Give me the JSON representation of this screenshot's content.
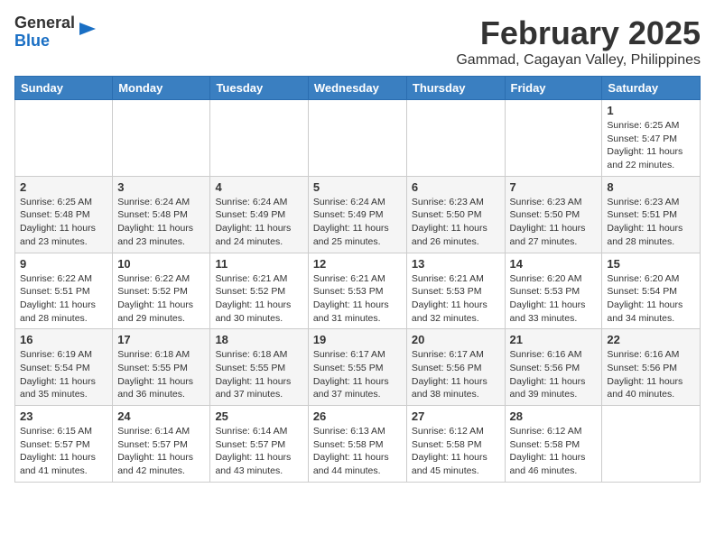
{
  "header": {
    "logo_general": "General",
    "logo_blue": "Blue",
    "month": "February 2025",
    "location": "Gammad, Cagayan Valley, Philippines"
  },
  "weekdays": [
    "Sunday",
    "Monday",
    "Tuesday",
    "Wednesday",
    "Thursday",
    "Friday",
    "Saturday"
  ],
  "weeks": [
    [
      {
        "day": "",
        "info": ""
      },
      {
        "day": "",
        "info": ""
      },
      {
        "day": "",
        "info": ""
      },
      {
        "day": "",
        "info": ""
      },
      {
        "day": "",
        "info": ""
      },
      {
        "day": "",
        "info": ""
      },
      {
        "day": "1",
        "info": "Sunrise: 6:25 AM\nSunset: 5:47 PM\nDaylight: 11 hours\nand 22 minutes."
      }
    ],
    [
      {
        "day": "2",
        "info": "Sunrise: 6:25 AM\nSunset: 5:48 PM\nDaylight: 11 hours\nand 23 minutes."
      },
      {
        "day": "3",
        "info": "Sunrise: 6:24 AM\nSunset: 5:48 PM\nDaylight: 11 hours\nand 23 minutes."
      },
      {
        "day": "4",
        "info": "Sunrise: 6:24 AM\nSunset: 5:49 PM\nDaylight: 11 hours\nand 24 minutes."
      },
      {
        "day": "5",
        "info": "Sunrise: 6:24 AM\nSunset: 5:49 PM\nDaylight: 11 hours\nand 25 minutes."
      },
      {
        "day": "6",
        "info": "Sunrise: 6:23 AM\nSunset: 5:50 PM\nDaylight: 11 hours\nand 26 minutes."
      },
      {
        "day": "7",
        "info": "Sunrise: 6:23 AM\nSunset: 5:50 PM\nDaylight: 11 hours\nand 27 minutes."
      },
      {
        "day": "8",
        "info": "Sunrise: 6:23 AM\nSunset: 5:51 PM\nDaylight: 11 hours\nand 28 minutes."
      }
    ],
    [
      {
        "day": "9",
        "info": "Sunrise: 6:22 AM\nSunset: 5:51 PM\nDaylight: 11 hours\nand 28 minutes."
      },
      {
        "day": "10",
        "info": "Sunrise: 6:22 AM\nSunset: 5:52 PM\nDaylight: 11 hours\nand 29 minutes."
      },
      {
        "day": "11",
        "info": "Sunrise: 6:21 AM\nSunset: 5:52 PM\nDaylight: 11 hours\nand 30 minutes."
      },
      {
        "day": "12",
        "info": "Sunrise: 6:21 AM\nSunset: 5:53 PM\nDaylight: 11 hours\nand 31 minutes."
      },
      {
        "day": "13",
        "info": "Sunrise: 6:21 AM\nSunset: 5:53 PM\nDaylight: 11 hours\nand 32 minutes."
      },
      {
        "day": "14",
        "info": "Sunrise: 6:20 AM\nSunset: 5:53 PM\nDaylight: 11 hours\nand 33 minutes."
      },
      {
        "day": "15",
        "info": "Sunrise: 6:20 AM\nSunset: 5:54 PM\nDaylight: 11 hours\nand 34 minutes."
      }
    ],
    [
      {
        "day": "16",
        "info": "Sunrise: 6:19 AM\nSunset: 5:54 PM\nDaylight: 11 hours\nand 35 minutes."
      },
      {
        "day": "17",
        "info": "Sunrise: 6:18 AM\nSunset: 5:55 PM\nDaylight: 11 hours\nand 36 minutes."
      },
      {
        "day": "18",
        "info": "Sunrise: 6:18 AM\nSunset: 5:55 PM\nDaylight: 11 hours\nand 37 minutes."
      },
      {
        "day": "19",
        "info": "Sunrise: 6:17 AM\nSunset: 5:55 PM\nDaylight: 11 hours\nand 37 minutes."
      },
      {
        "day": "20",
        "info": "Sunrise: 6:17 AM\nSunset: 5:56 PM\nDaylight: 11 hours\nand 38 minutes."
      },
      {
        "day": "21",
        "info": "Sunrise: 6:16 AM\nSunset: 5:56 PM\nDaylight: 11 hours\nand 39 minutes."
      },
      {
        "day": "22",
        "info": "Sunrise: 6:16 AM\nSunset: 5:56 PM\nDaylight: 11 hours\nand 40 minutes."
      }
    ],
    [
      {
        "day": "23",
        "info": "Sunrise: 6:15 AM\nSunset: 5:57 PM\nDaylight: 11 hours\nand 41 minutes."
      },
      {
        "day": "24",
        "info": "Sunrise: 6:14 AM\nSunset: 5:57 PM\nDaylight: 11 hours\nand 42 minutes."
      },
      {
        "day": "25",
        "info": "Sunrise: 6:14 AM\nSunset: 5:57 PM\nDaylight: 11 hours\nand 43 minutes."
      },
      {
        "day": "26",
        "info": "Sunrise: 6:13 AM\nSunset: 5:58 PM\nDaylight: 11 hours\nand 44 minutes."
      },
      {
        "day": "27",
        "info": "Sunrise: 6:12 AM\nSunset: 5:58 PM\nDaylight: 11 hours\nand 45 minutes."
      },
      {
        "day": "28",
        "info": "Sunrise: 6:12 AM\nSunset: 5:58 PM\nDaylight: 11 hours\nand 46 minutes."
      },
      {
        "day": "",
        "info": ""
      }
    ]
  ]
}
